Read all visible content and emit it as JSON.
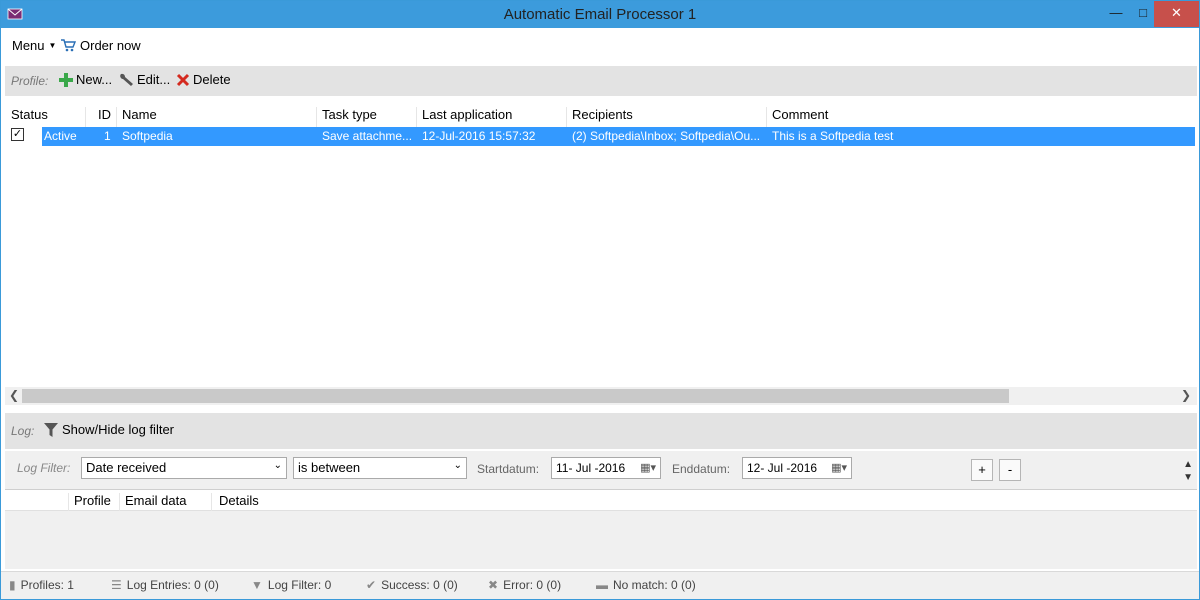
{
  "window": {
    "title": "Automatic Email Processor 1"
  },
  "menubar": {
    "menu_label": "Menu",
    "order_label": "Order now"
  },
  "profile_toolbar": {
    "label": "Profile:",
    "new_label": "New...",
    "edit_label": "Edit...",
    "delete_label": "Delete"
  },
  "profiles_table": {
    "columns": [
      "Status",
      "ID",
      "Name",
      "Task type",
      "Last application",
      "Recipients",
      "Comment"
    ],
    "rows": [
      {
        "checked": true,
        "status": "Active",
        "id": "1",
        "name": "Softpedia",
        "task_type": "Save attachme...",
        "last_application": "12-Jul-2016 15:57:32",
        "recipients": "(2) Softpedia\\Inbox; Softpedia\\Ou...",
        "comment": "This is a Softpedia test"
      }
    ]
  },
  "log_toolbar": {
    "label": "Log:",
    "toggle_label": "Show/Hide log filter"
  },
  "log_filter": {
    "label": "Log Filter:",
    "field_value": "Date received",
    "operator_value": "is between",
    "start_label": "Startdatum:",
    "start_value": "11- Jul  -2016",
    "end_label": "Enddatum:",
    "end_value": "12- Jul  -2016",
    "add_label": "+",
    "remove_label": "-"
  },
  "log_table": {
    "columns": [
      "Profile",
      "Email data",
      "Details"
    ]
  },
  "statusbar": {
    "profiles": "Profiles: 1",
    "log_entries": "Log Entries: 0 (0)",
    "log_filter": "Log Filter: 0",
    "success": "Success: 0 (0)",
    "error": "Error: 0 (0)",
    "no_match": "No match: 0 (0)"
  },
  "colors": {
    "titlebar": "#3c9bdc",
    "selection": "#3399ff",
    "close_button": "#c7504b"
  }
}
